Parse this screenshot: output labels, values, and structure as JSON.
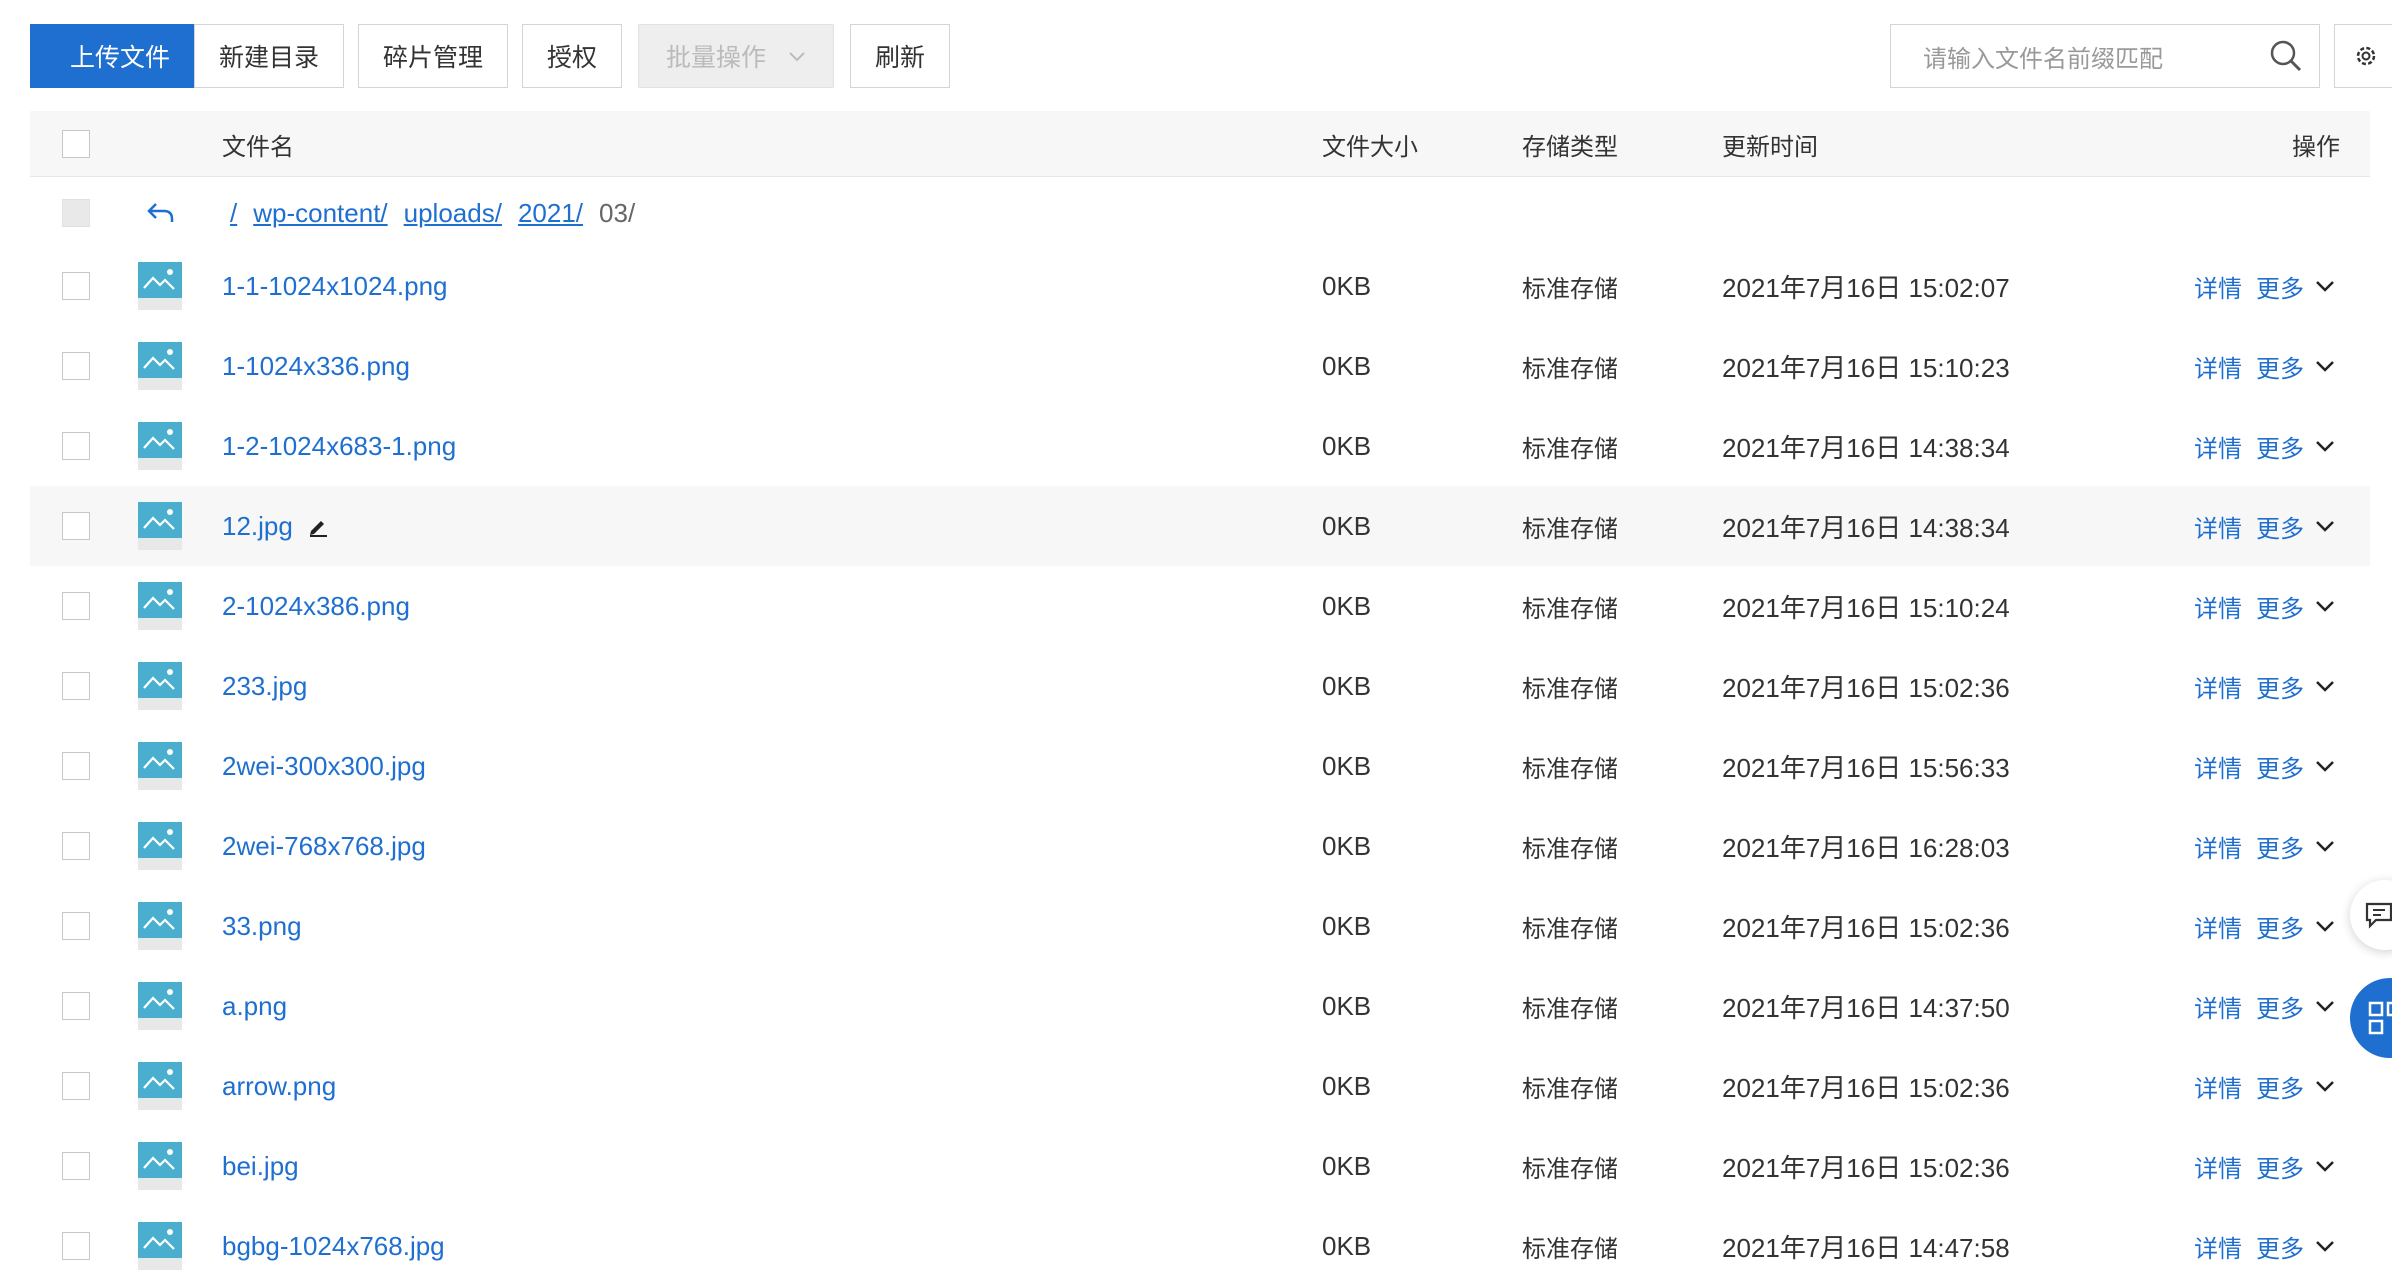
{
  "toolbar": {
    "upload": "上传文件",
    "new_dir": "新建目录",
    "fragments": "碎片管理",
    "authorize": "授权",
    "batch": "批量操作",
    "refresh": "刷新",
    "search_placeholder": "请输入文件名前缀匹配"
  },
  "table": {
    "headers": {
      "name": "文件名",
      "size": "文件大小",
      "storage": "存储类型",
      "updated": "更新时间",
      "actions": "操作"
    },
    "breadcrumb": [
      "/",
      "wp-content/",
      "uploads/",
      "2021/"
    ],
    "breadcrumb_current": "03/",
    "rows": [
      {
        "name": "1-1-1024x1024.png",
        "size": "0KB",
        "storage": "标准存储",
        "updated": "2021年7月16日 15:02:07"
      },
      {
        "name": "1-1024x336.png",
        "size": "0KB",
        "storage": "标准存储",
        "updated": "2021年7月16日 15:10:23"
      },
      {
        "name": "1-2-1024x683-1.png",
        "size": "0KB",
        "storage": "标准存储",
        "updated": "2021年7月16日 14:38:34"
      },
      {
        "name": "12.jpg",
        "size": "0KB",
        "storage": "标准存储",
        "updated": "2021年7月16日 14:38:34"
      },
      {
        "name": "2-1024x386.png",
        "size": "0KB",
        "storage": "标准存储",
        "updated": "2021年7月16日 15:10:24"
      },
      {
        "name": "233.jpg",
        "size": "0KB",
        "storage": "标准存储",
        "updated": "2021年7月16日 15:02:36"
      },
      {
        "name": "2wei-300x300.jpg",
        "size": "0KB",
        "storage": "标准存储",
        "updated": "2021年7月16日 15:56:33"
      },
      {
        "name": "2wei-768x768.jpg",
        "size": "0KB",
        "storage": "标准存储",
        "updated": "2021年7月16日 16:28:03"
      },
      {
        "name": "33.png",
        "size": "0KB",
        "storage": "标准存储",
        "updated": "2021年7月16日 15:02:36"
      },
      {
        "name": "a.png",
        "size": "0KB",
        "storage": "标准存储",
        "updated": "2021年7月16日 14:37:50"
      },
      {
        "name": "arrow.png",
        "size": "0KB",
        "storage": "标准存储",
        "updated": "2021年7月16日 15:02:36"
      },
      {
        "name": "bei.jpg",
        "size": "0KB",
        "storage": "标准存储",
        "updated": "2021年7月16日 15:02:36"
      },
      {
        "name": "bgbg-1024x768.jpg",
        "size": "0KB",
        "storage": "标准存储",
        "updated": "2021年7月16日 14:47:58"
      }
    ],
    "row_actions": {
      "detail": "详情",
      "more": "更多"
    }
  },
  "colors": {
    "accent": "#1f6fd0",
    "thumb": "#4aaecf"
  }
}
